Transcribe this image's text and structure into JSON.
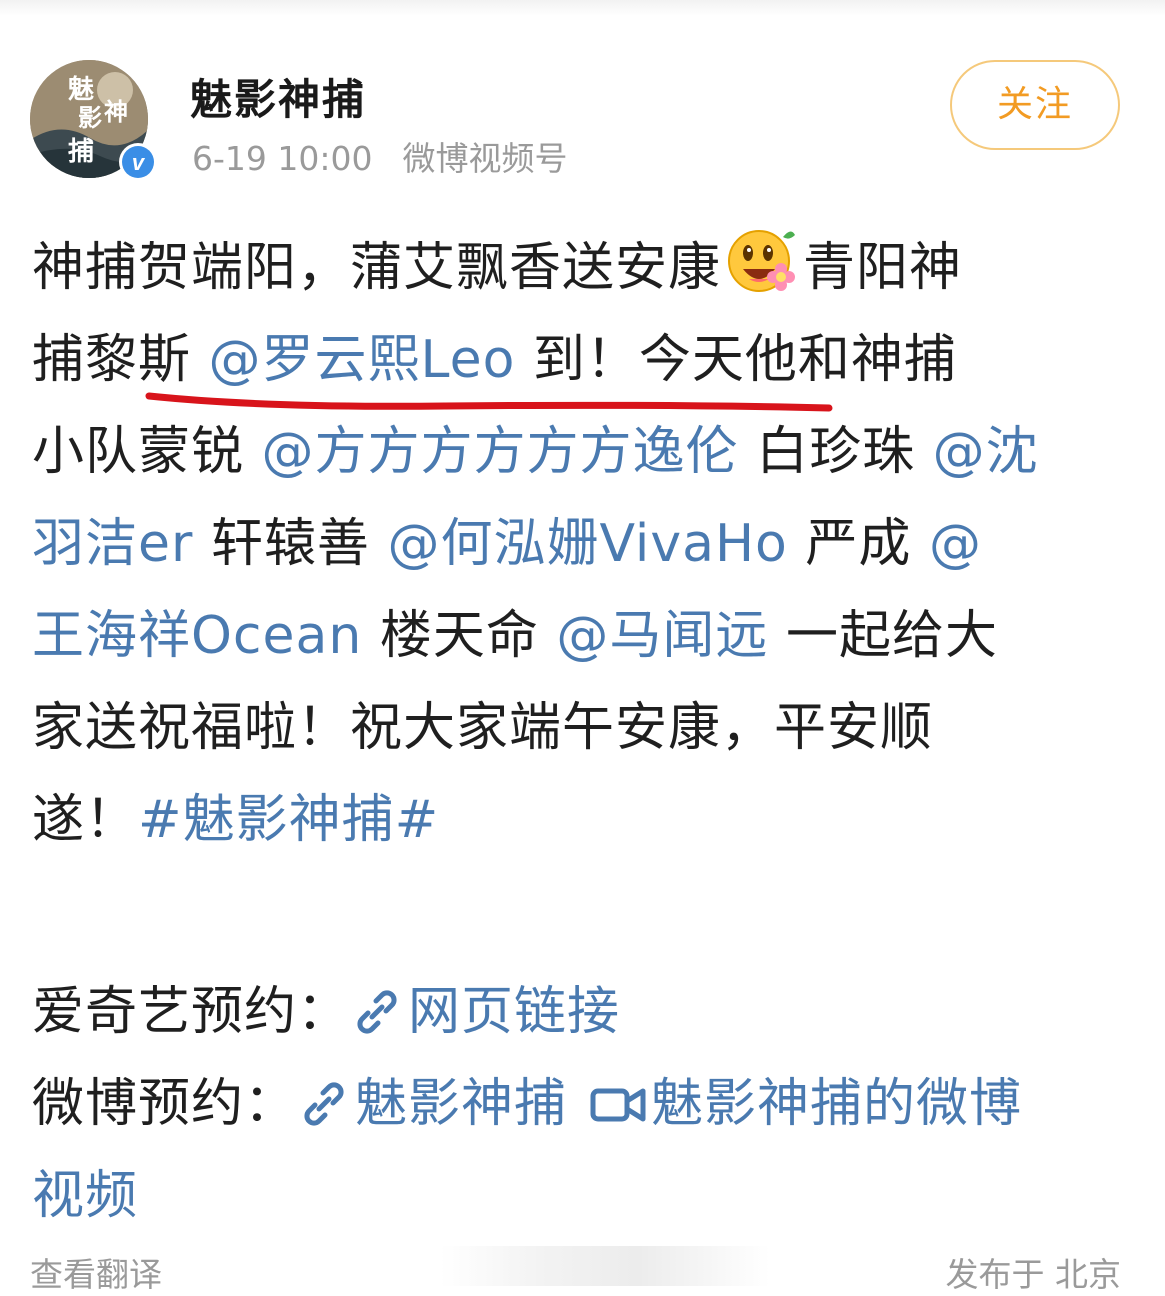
{
  "header": {
    "username": "魅影神捕",
    "date": "6-19 10:00",
    "source": "微博视频号",
    "follow_label": "关注",
    "avatar_text": "魅影神捕"
  },
  "post": {
    "line1": {
      "before_emoji": "神捕贺端阳，蒲艾飘香送安康",
      "emoji_name": "flower-smile-emoji",
      "after_emoji": "青阳神"
    },
    "line2": {
      "a": "捕黎斯 ",
      "mention": "@罗云熙Leo",
      "b": " 到！今天他和神捕"
    },
    "line3": {
      "a": "小队蒙锐 ",
      "mention1": "@方方方方方方逸伦",
      "b": " 白珍珠 ",
      "mention2_start": "@沈"
    },
    "line4": {
      "mention2_end": "羽洁er",
      "a": " 轩辕善 ",
      "mention3": "@何泓姗VivaHo",
      "b": " 严成 ",
      "mention4_start": "@"
    },
    "line5": {
      "mention4_end": "王海祥Ocean",
      "a": " 楼天命 ",
      "mention5": "@马闻远",
      "b": " 一起给大"
    },
    "line6": "家送祝福啦！祝大家端午安康，平安顺",
    "line7": {
      "a": "遂！",
      "topic": "#魅影神捕#"
    }
  },
  "links": {
    "iqiyi_label": "爱奇艺预约：",
    "iqiyi_link": "网页链接",
    "weibo_label": "微博预约：",
    "weibo_link": "魅影神捕",
    "video_link_part1": "魅影神捕的微博",
    "video_link_part2": "视频"
  },
  "footer": {
    "translate": "查看翻译",
    "location": "发布于 北京"
  },
  "colors": {
    "link": "#4a7ab0",
    "follow": "#f29b23",
    "follow_border": "#f5c97b",
    "meta": "#9a9a9a",
    "underline_mark": "#d8141b",
    "verified": "#3a8ee6"
  }
}
